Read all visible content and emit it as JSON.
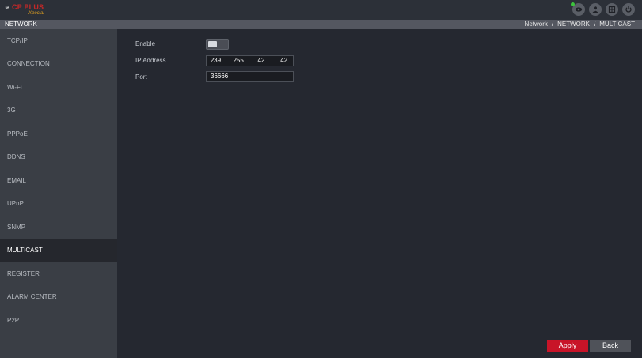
{
  "logo": {
    "brand": "CP PLUS",
    "sub": "Xpecial"
  },
  "top_icons": [
    "eye-icon",
    "user-icon",
    "grid-menu-icon",
    "power-icon"
  ],
  "header": {
    "title": "NETWORK",
    "breadcrumb": [
      "Network",
      "NETWORK",
      "MULTICAST"
    ]
  },
  "sidebar": {
    "items": [
      {
        "label": "TCP/IP"
      },
      {
        "label": "CONNECTION"
      },
      {
        "label": "Wi-Fi"
      },
      {
        "label": "3G"
      },
      {
        "label": "PPPoE"
      },
      {
        "label": "DDNS"
      },
      {
        "label": "EMAIL"
      },
      {
        "label": "UPnP"
      },
      {
        "label": "SNMP"
      },
      {
        "label": "MULTICAST"
      },
      {
        "label": "REGISTER"
      },
      {
        "label": "ALARM CENTER"
      },
      {
        "label": "P2P"
      }
    ],
    "active": "MULTICAST"
  },
  "form": {
    "enable_label": "Enable",
    "enable_value": false,
    "ip_label": "IP Address",
    "ip_octets": [
      "239",
      "255",
      "42",
      "42"
    ],
    "ip_separator": ".",
    "port_label": "Port",
    "port_value": "36666"
  },
  "buttons": {
    "apply": "Apply",
    "back": "Back"
  },
  "colors": {
    "accent": "#c81428",
    "status": "#3cc43c"
  }
}
